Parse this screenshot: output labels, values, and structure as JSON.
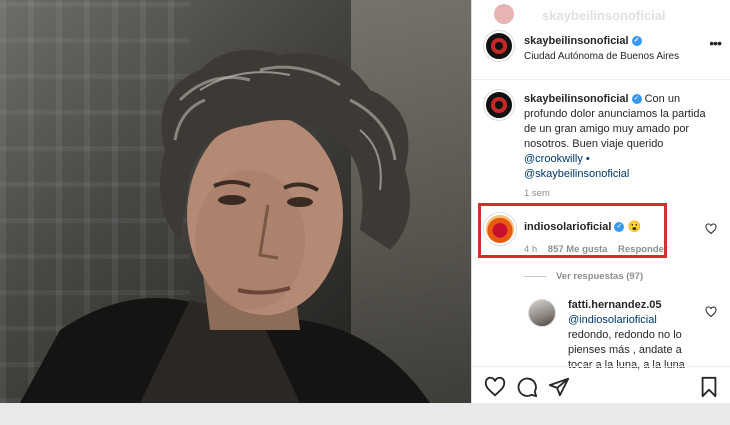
{
  "ghost_header": {
    "username": "skaybeilinsonoficial"
  },
  "post": {
    "author": "skaybeilinsonoficial",
    "location": "Ciudad Autónoma de Buenos Aires",
    "more_label": "•••"
  },
  "caption": {
    "author": "skaybeilinsonoficial",
    "text": "Con un profundo dolor anunciamos la partida de un gran amigo muy amado por nosotros. Buen viaje querido",
    "mention_1": "@crookwilly",
    "separator": "•",
    "mention_2": "@skaybeilinsonoficial",
    "time": "1 sem"
  },
  "comment": {
    "author": "indiosolarioficial",
    "emoji": "😮",
    "time": "4 h",
    "likes": "857 Me gusta",
    "reply": "Responder",
    "view_replies": "Ver respuestas (97)"
  },
  "reply": {
    "author": "fatti.hernandez.05",
    "mention": "@indiosolarioficial",
    "text": "redondo, redondo no lo pienses más , andate a",
    "text_cut": "tocar a la luna, a la luna"
  },
  "colors": {
    "highlight_border": "#d32f2f",
    "verified": "#3897f0",
    "mention": "#00376b",
    "meta": "#8e8e8e"
  },
  "icons": [
    "heart-icon",
    "comment-icon",
    "share-icon",
    "bookmark-icon",
    "verified-icon",
    "more-icon"
  ]
}
